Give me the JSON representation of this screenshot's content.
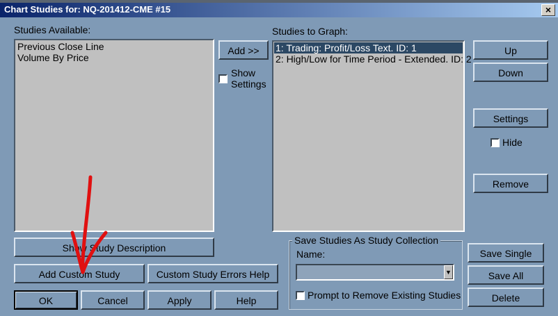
{
  "title": "Chart Studies for: NQ-201412-CME  #15",
  "close_label": "×",
  "studies_available": {
    "label": "Studies Available:",
    "items": [
      "Previous Close Line",
      "Volume By Price"
    ]
  },
  "studies_to_graph": {
    "label": "Studies to Graph:",
    "items": [
      "1: Trading: Profit/Loss Text. ID: 1",
      "2: High/Low for Time Period - Extended. ID: 2"
    ]
  },
  "add_label": "Add >>",
  "show_settings_line1": "Show",
  "show_settings_line2": "Settings",
  "up_label": "Up",
  "down_label": "Down",
  "settings_label": "Settings",
  "hide_label": "Hide",
  "remove_label": "Remove",
  "show_description_label": "Show Study Description",
  "add_custom_label": "Add Custom Study",
  "custom_errors_label": "Custom Study Errors Help",
  "ok_label": "OK",
  "cancel_label": "Cancel",
  "apply_label": "Apply",
  "help_label": "Help",
  "collection": {
    "title": "Save Studies As Study Collection",
    "name_label": "Name:",
    "name_value": "",
    "prompt_label": "Prompt to Remove Existing Studies"
  },
  "save_single_label": "Save Single",
  "save_all_label": "Save All",
  "delete_label": "Delete",
  "annotation_color": "#e01010"
}
